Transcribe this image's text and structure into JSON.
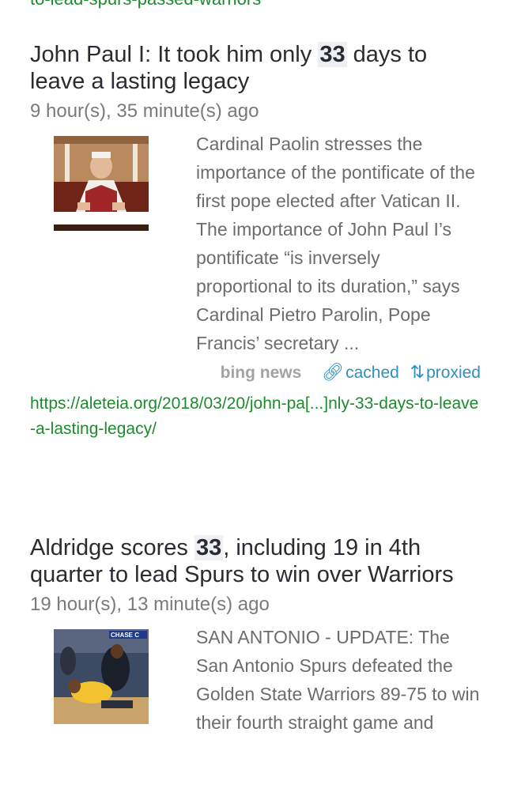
{
  "prev_result": {
    "url_tail": "to-lead-spurs-passed-warriors"
  },
  "results": [
    {
      "title_before": "John Paul I: It took him only ",
      "title_highlight": "33",
      "title_after": " days to leave a lasting legacy",
      "time": "9 hour(s), 35 minute(s) ago",
      "snippet": "Cardinal Paolin stresses the importance of the pontificate of the first pope elected after Vatican II. The importance of John Paul I’s pontificate “is inversely proportional to its duration,” says Cardinal Pietro Parolin, Pope Francis’ secretary ...",
      "engine": "bing news",
      "cached_label": "cached",
      "proxied_label": "proxied",
      "url": "https://aleteia.org/2018/03/20/john-pa[...]nly-33-days-to-leave-a-lasting-legacy/",
      "thumbnail_icon": "pope-photo-thumbnail"
    },
    {
      "title_before": "Aldridge scores ",
      "title_highlight": "33",
      "title_after": ", including 19 in 4th quarter to lead Spurs to win over Warriors",
      "time": "19 hour(s), 13 minute(s) ago",
      "snippet": "SAN ANTONIO - UPDATE: The San Antonio Spurs defeated the Golden State Warriors 89-75 to win their fourth straight game and",
      "thumbnail_icon": "basketball-photo-thumbnail",
      "thumbnail_text": "CHASE C"
    }
  ],
  "colors": {
    "url_green": "#1e8a2f",
    "link_blue": "#2f8fbf",
    "title": "#2b2b33",
    "muted": "#7a7a7a"
  }
}
